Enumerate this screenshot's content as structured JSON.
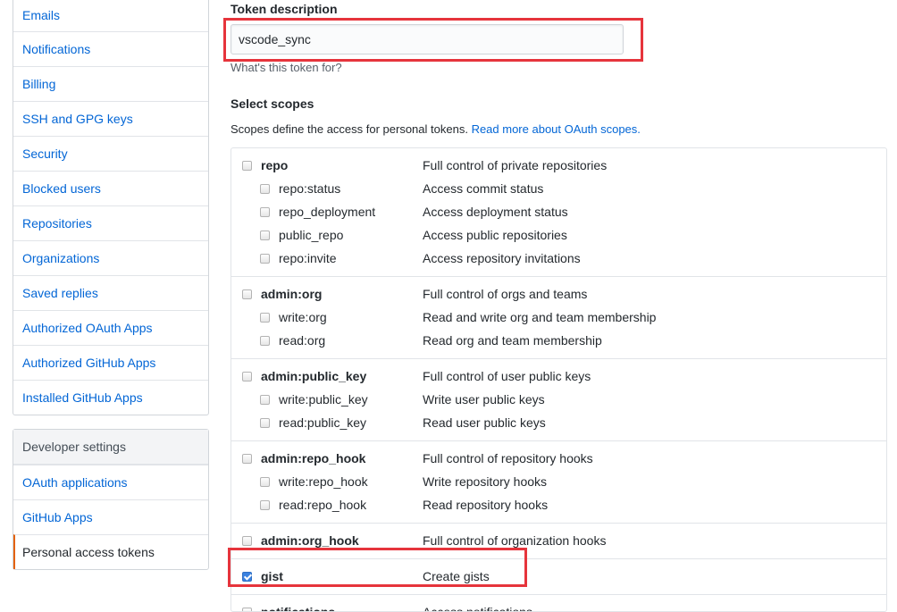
{
  "sidebar": {
    "items": [
      {
        "label": "Emails"
      },
      {
        "label": "Notifications"
      },
      {
        "label": "Billing"
      },
      {
        "label": "SSH and GPG keys"
      },
      {
        "label": "Security"
      },
      {
        "label": "Blocked users"
      },
      {
        "label": "Repositories"
      },
      {
        "label": "Organizations"
      },
      {
        "label": "Saved replies"
      },
      {
        "label": "Authorized OAuth Apps"
      },
      {
        "label": "Authorized GitHub Apps"
      },
      {
        "label": "Installed GitHub Apps"
      }
    ],
    "developer": {
      "heading": "Developer settings",
      "items": [
        {
          "label": "OAuth applications"
        },
        {
          "label": "GitHub Apps"
        },
        {
          "label": "Personal access tokens",
          "selected": true
        }
      ]
    }
  },
  "form": {
    "token_label": "Token description",
    "token_value": "vscode_sync",
    "token_note": "What's this token for?",
    "scopes_title": "Select scopes",
    "scopes_desc": "Scopes define the access for personal tokens.",
    "scopes_link": "Read more about OAuth scopes."
  },
  "scopes": [
    {
      "name": "repo",
      "desc": "Full control of private repositories",
      "checked": false,
      "children": [
        {
          "name": "repo:status",
          "desc": "Access commit status",
          "checked": false
        },
        {
          "name": "repo_deployment",
          "desc": "Access deployment status",
          "checked": false
        },
        {
          "name": "public_repo",
          "desc": "Access public repositories",
          "checked": false
        },
        {
          "name": "repo:invite",
          "desc": "Access repository invitations",
          "checked": false
        }
      ]
    },
    {
      "name": "admin:org",
      "desc": "Full control of orgs and teams",
      "checked": false,
      "children": [
        {
          "name": "write:org",
          "desc": "Read and write org and team membership",
          "checked": false
        },
        {
          "name": "read:org",
          "desc": "Read org and team membership",
          "checked": false
        }
      ]
    },
    {
      "name": "admin:public_key",
      "desc": "Full control of user public keys",
      "checked": false,
      "children": [
        {
          "name": "write:public_key",
          "desc": "Write user public keys",
          "checked": false
        },
        {
          "name": "read:public_key",
          "desc": "Read user public keys",
          "checked": false
        }
      ]
    },
    {
      "name": "admin:repo_hook",
      "desc": "Full control of repository hooks",
      "checked": false,
      "children": [
        {
          "name": "write:repo_hook",
          "desc": "Write repository hooks",
          "checked": false
        },
        {
          "name": "read:repo_hook",
          "desc": "Read repository hooks",
          "checked": false
        }
      ]
    },
    {
      "name": "admin:org_hook",
      "desc": "Full control of organization hooks",
      "checked": false,
      "children": []
    },
    {
      "name": "gist",
      "desc": "Create gists",
      "checked": true,
      "children": []
    },
    {
      "name": "notifications",
      "desc": "Access notifications",
      "checked": false,
      "children": []
    }
  ],
  "colors": {
    "link": "#0366d6",
    "highlight": "#e6343c",
    "selected_accent": "#e36209"
  }
}
